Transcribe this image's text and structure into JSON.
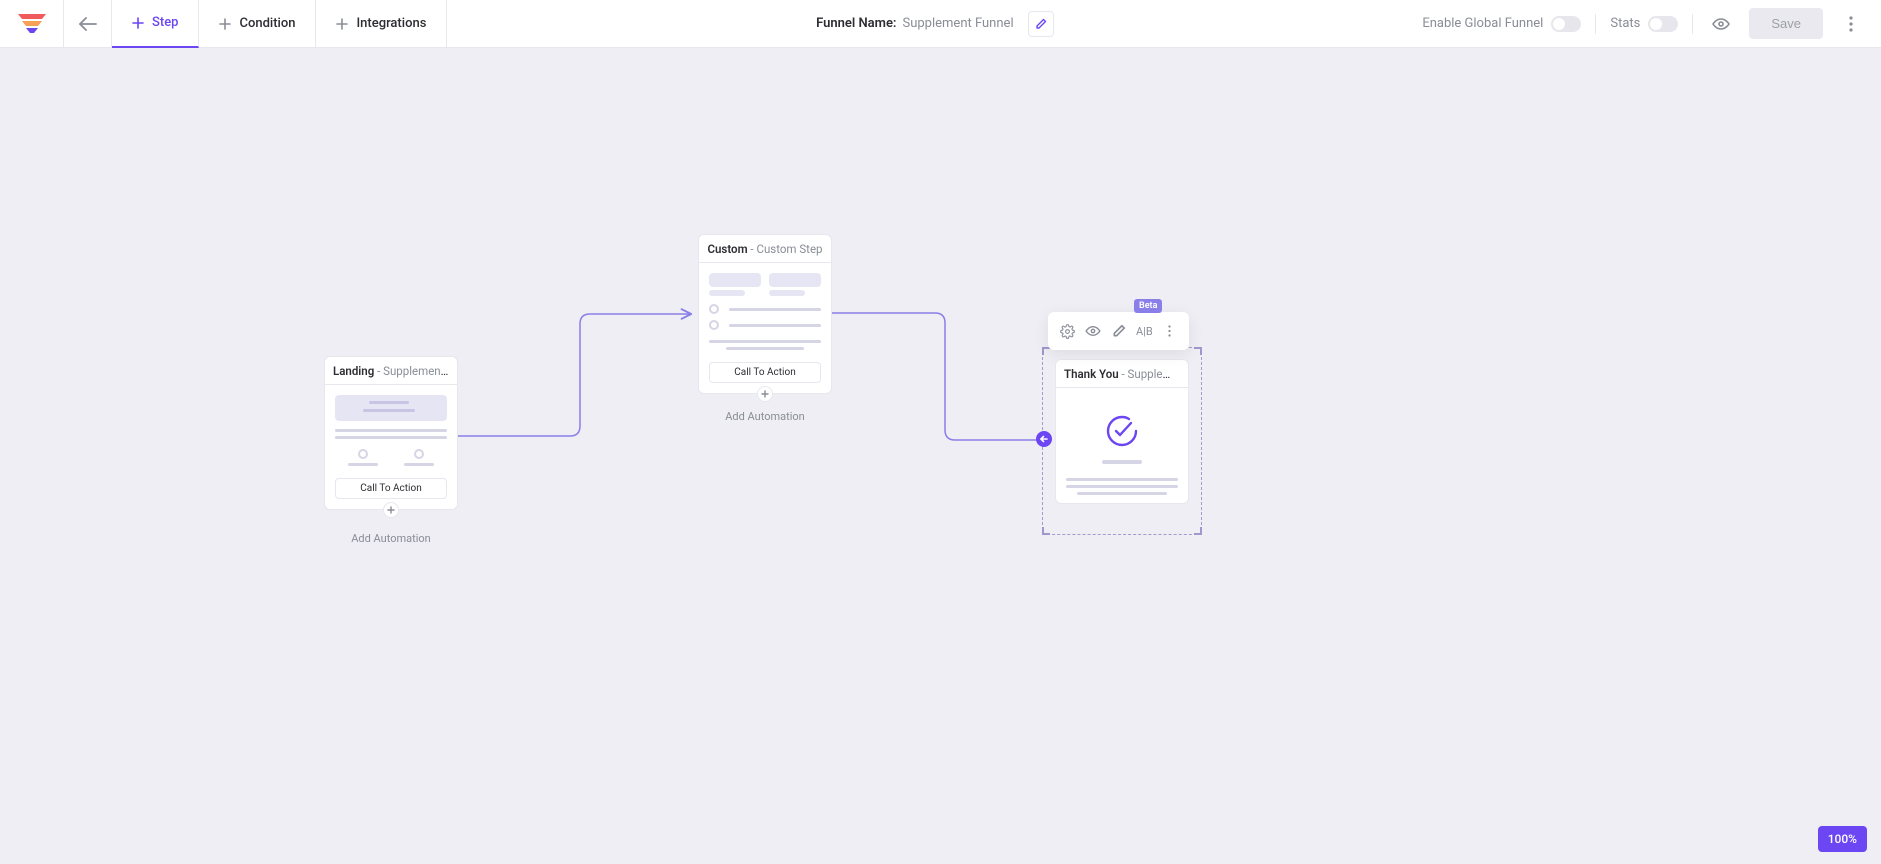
{
  "header": {
    "tabs": {
      "step": "Step",
      "condition": "Condition",
      "integrations": "Integrations"
    },
    "funnel_name_label": "Funnel Name:",
    "funnel_name_value": "Supplement Funnel",
    "enable_global": "Enable Global Funnel",
    "stats": "Stats",
    "save": "Save"
  },
  "steps": {
    "landing": {
      "type": "Landing",
      "sep": " - ",
      "name": "Supplement La…",
      "cta": "Call To Action",
      "add_automation": "Add Automation"
    },
    "custom": {
      "type": "Custom",
      "sep": " - ",
      "name": "Custom Step",
      "cta": "Call To Action",
      "add_automation": "Add Automation"
    },
    "thankyou": {
      "type": "Thank You",
      "sep": " - ",
      "name": "Supplement T…"
    }
  },
  "action_bar": {
    "ab": "A|B",
    "beta": "Beta"
  },
  "zoom": "100%"
}
